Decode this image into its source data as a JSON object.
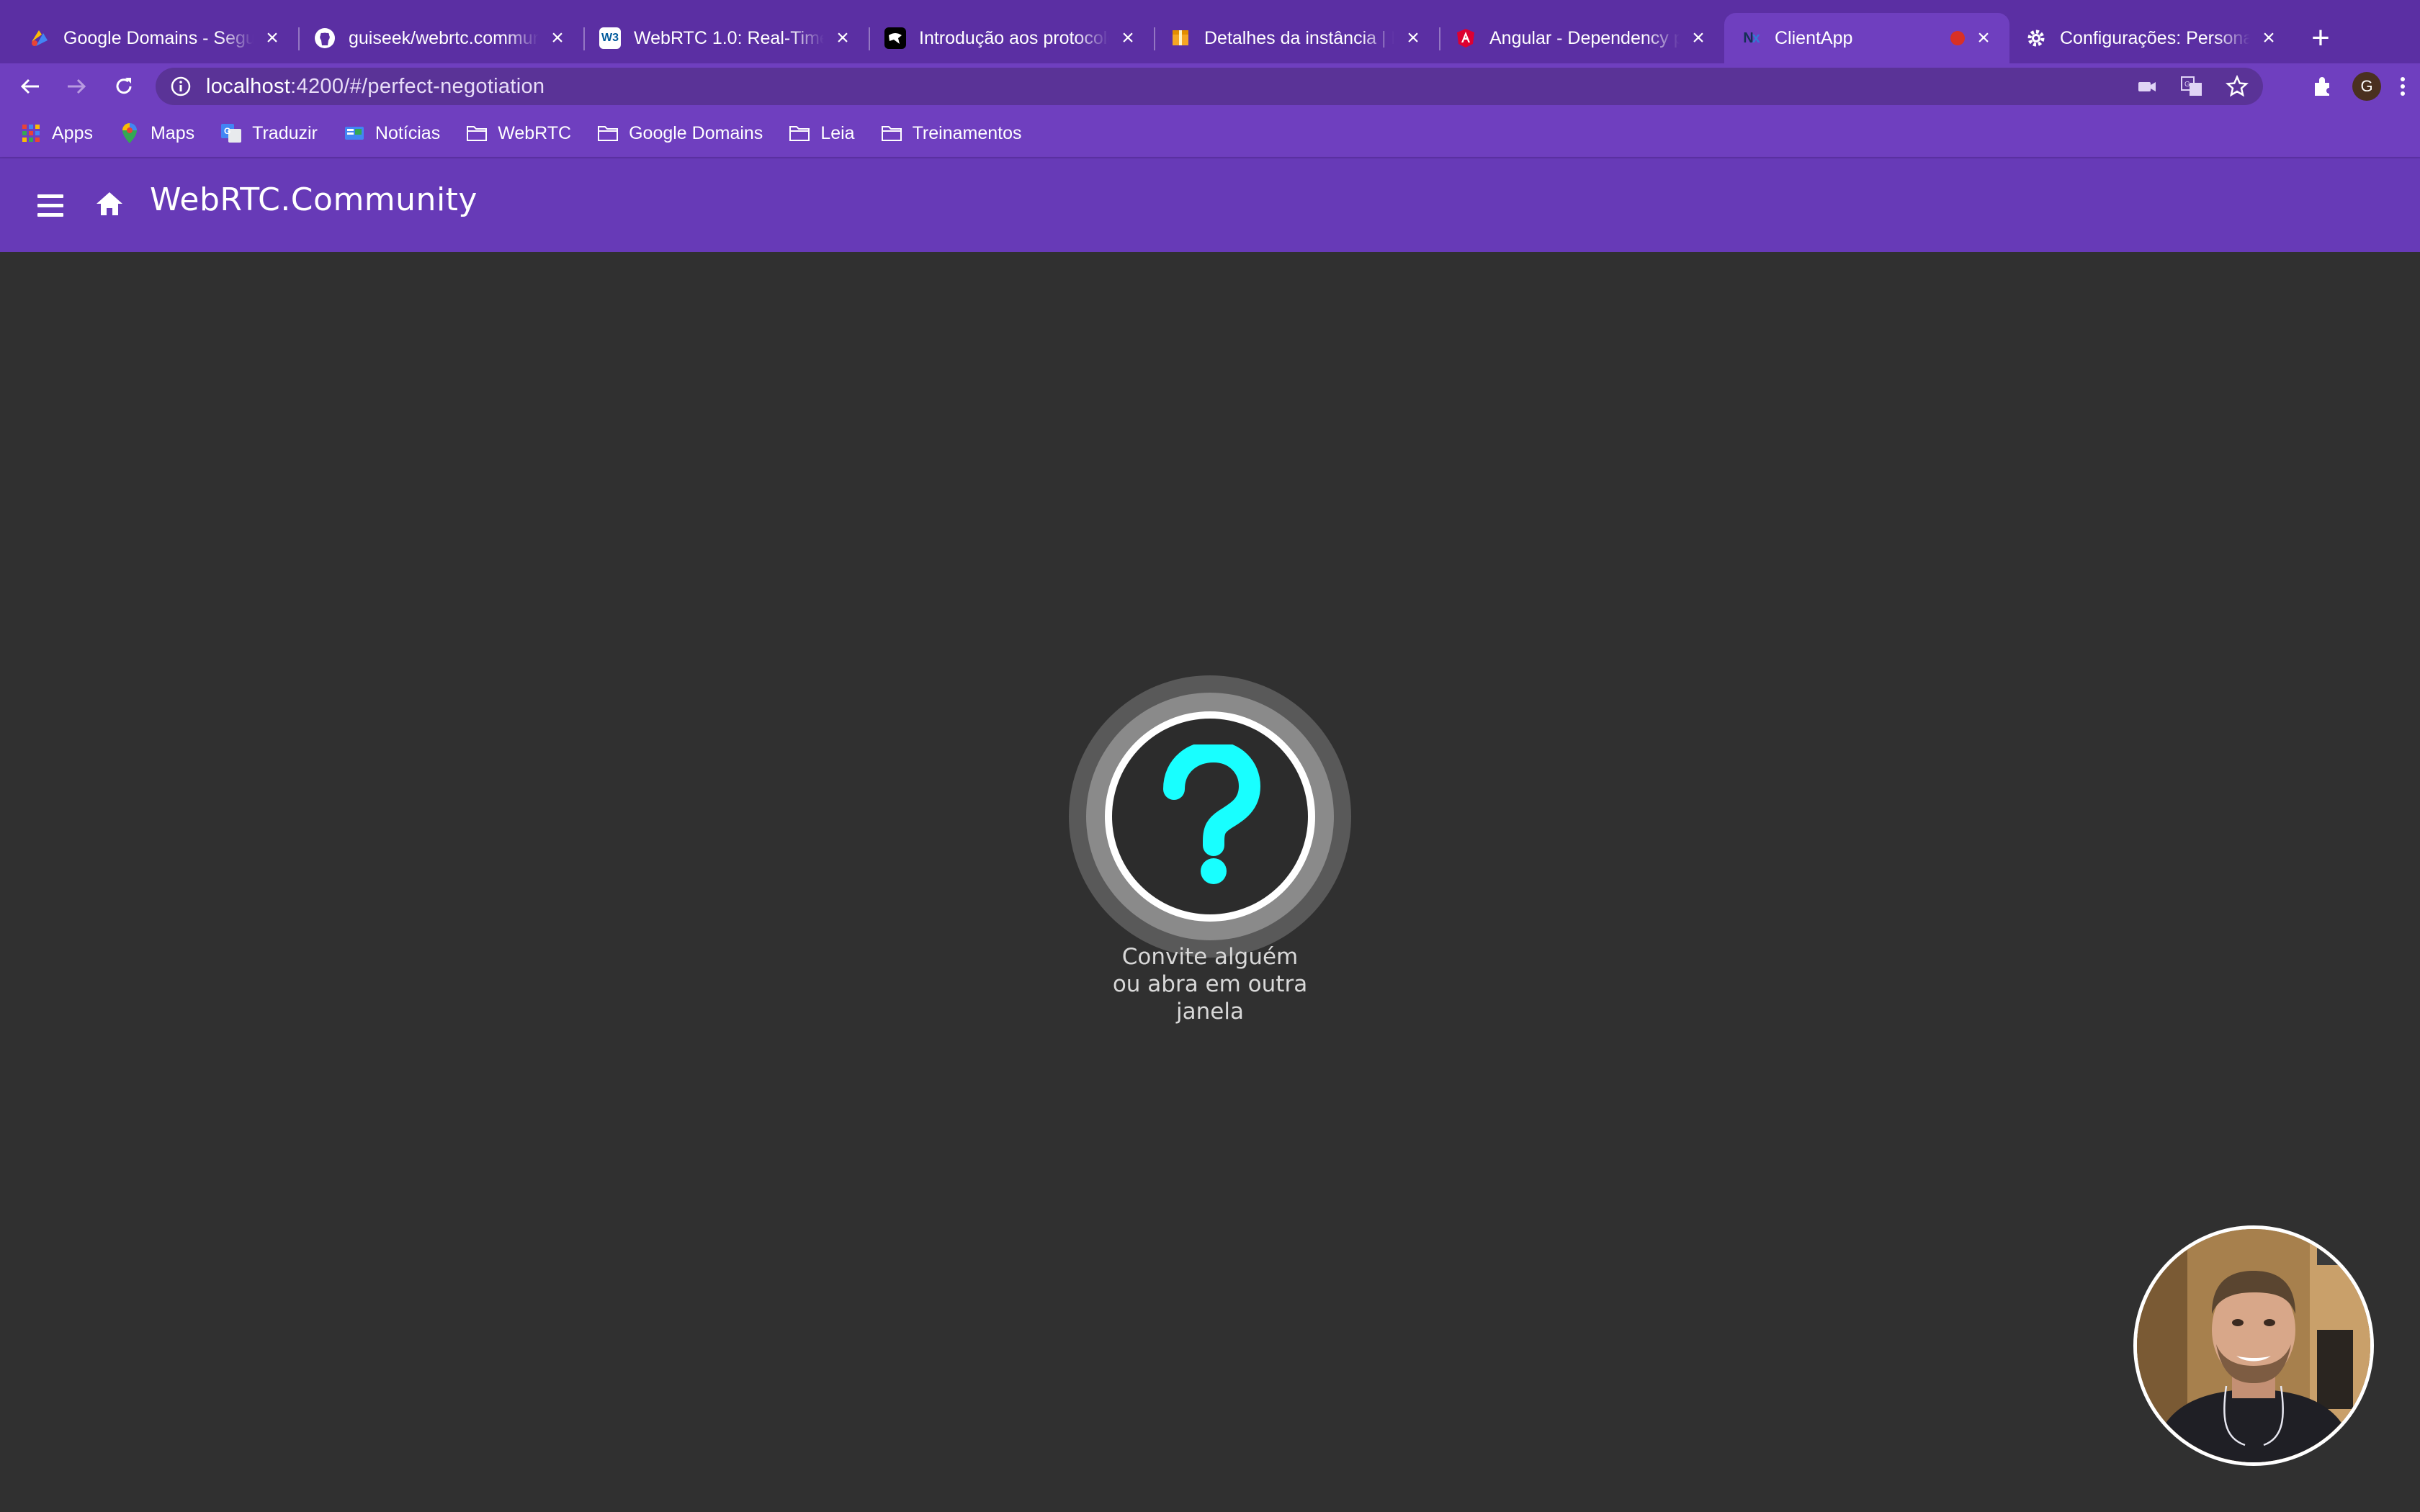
{
  "browser": {
    "tabs": [
      {
        "title": "Google Domains - Segurança",
        "favicon": "google-domains-icon",
        "active": false
      },
      {
        "title": "guiseek/webrtc.community",
        "favicon": "github-icon",
        "active": false
      },
      {
        "title": "WebRTC 1.0: Real-Time Communication",
        "favicon": "w3c-icon",
        "active": false
      },
      {
        "title": "Introdução aos protocolos",
        "favicon": "mdn-icon",
        "active": false
      },
      {
        "title": "Detalhes da instância | Lightsail",
        "favicon": "aws-box-icon",
        "active": false
      },
      {
        "title": "Angular - Dependency providers",
        "favicon": "angular-icon",
        "active": false
      },
      {
        "title": "ClientApp",
        "favicon": "nx-icon",
        "active": true,
        "recording": true
      },
      {
        "title": "Configurações: Personalizar",
        "favicon": "settings-gear-icon",
        "active": false
      }
    ],
    "address": {
      "host": "localhost",
      "rest": ":4200/#/perfect-negotiation"
    },
    "profile_initial": "G",
    "bookmarks": [
      {
        "label": "Apps",
        "icon": "apps-grid-icon"
      },
      {
        "label": "Maps",
        "icon": "maps-pin-icon"
      },
      {
        "label": "Traduzir",
        "icon": "translate-icon"
      },
      {
        "label": "Notícias",
        "icon": "news-icon"
      },
      {
        "label": "WebRTC",
        "icon": "folder-icon"
      },
      {
        "label": "Google Domains",
        "icon": "folder-icon"
      },
      {
        "label": "Leia",
        "icon": "folder-icon"
      },
      {
        "label": "Treinamentos",
        "icon": "folder-icon"
      }
    ]
  },
  "app": {
    "title": "WebRTC.Community",
    "header_color": "#673ab7",
    "invite": {
      "line1": "Convite alguém",
      "line2": "ou abra em outra",
      "line3": "janela",
      "icon": "question-mark-icon",
      "icon_color": "#18ffff"
    }
  }
}
